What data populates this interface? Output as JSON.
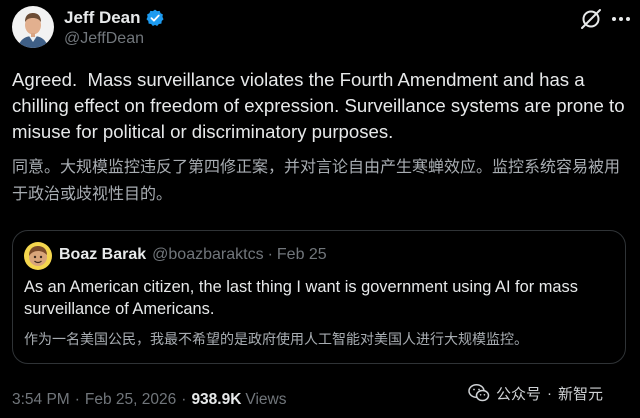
{
  "author": {
    "name": "Jeff Dean",
    "handle": "@JeffDean",
    "verified": true
  },
  "icons": {
    "verified": "verified-badge-icon",
    "grok": "grok-icon",
    "more": "more-options-icon",
    "watermark": "wechat-icon"
  },
  "colors": {
    "background": "#000000",
    "text": "#e7e9ea",
    "secondary": "#71767b",
    "verified": "#1d9bf0",
    "border": "#2f3336"
  },
  "tweet": {
    "text": "Agreed.  Mass surveillance violates the Fourth Amendment and has a chilling effect on freedom of expression. Surveillance systems are prone to misuse for political or discriminatory purposes.",
    "translation": "同意。大规模监控违反了第四修正案，并对言论自由产生寒蝉效应。监控系统容易被用于政治或歧视性目的。"
  },
  "quote": {
    "name": "Boaz Barak",
    "handle": "@boazbaraktcs",
    "separator": "·",
    "date": "Feb 25",
    "text": "As an American citizen, the last thing I want is government using AI for mass surveillance of Americans.",
    "translation": "作为一名美国公民，我最不希望的是政府使用人工智能对美国人进行大规模监控。"
  },
  "meta": {
    "time": "3:54 PM",
    "separator": "·",
    "date": "Feb 25, 2026",
    "views_count": "938.9K",
    "views_label": "Views"
  },
  "watermark": {
    "left_text": "公众号",
    "separator": "·",
    "right_text": "新智元"
  }
}
